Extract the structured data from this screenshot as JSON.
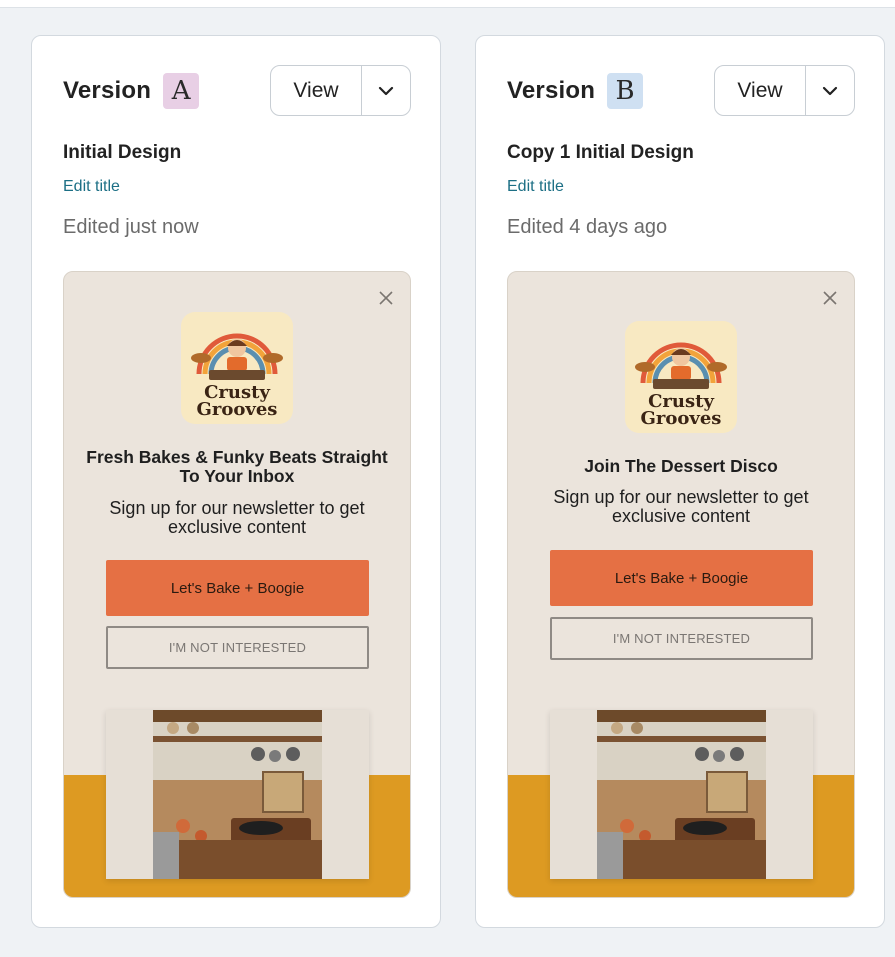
{
  "versions": [
    {
      "label": "Version",
      "badge": "A",
      "view_label": "View",
      "design_title": "Initial Design",
      "edit_title_label": "Edit title",
      "edited_text": "Edited just now",
      "preview": {
        "logo_text": [
          "Crusty",
          "Grooves"
        ],
        "headline": "Fresh Bakes & Funky Beats Straight To Your Inbox",
        "subline": "Sign up for our newsletter to get exclusive content",
        "cta_label": "Let's Bake + Boogie",
        "decline_label": "I'M NOT INTERESTED"
      }
    },
    {
      "label": "Version",
      "badge": "B",
      "view_label": "View",
      "design_title": "Copy 1 Initial Design",
      "edit_title_label": "Edit title",
      "edited_text": "Edited 4 days ago",
      "preview": {
        "logo_text": [
          "Crusty",
          "Grooves"
        ],
        "headline": "Join The Dessert Disco",
        "subline": "Sign up for our newsletter to get exclusive content",
        "cta_label": "Let's Bake + Boogie",
        "decline_label": "I'M NOT INTERESTED"
      }
    }
  ],
  "colors": {
    "accent_cta": "#e57044",
    "link": "#1c6f85",
    "preview_bg": "#ebe4dc",
    "preview_footer": "#dd9a22",
    "badge_a": "#e8cfe5",
    "badge_b": "#cfe0f2"
  },
  "icons": {
    "dropdown": "chevron-down-icon",
    "close": "close-icon"
  }
}
